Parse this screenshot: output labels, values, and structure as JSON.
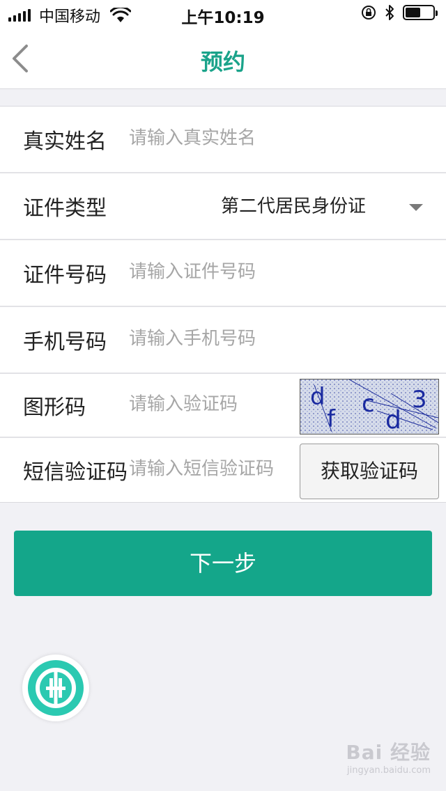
{
  "status_bar": {
    "carrier": "中国移动",
    "time": "上午10:19",
    "battery_level": 0.55
  },
  "nav": {
    "title": "预约"
  },
  "form": {
    "name": {
      "label": "真实姓名",
      "placeholder": "请输入真实姓名"
    },
    "id_type": {
      "label": "证件类型",
      "value": "第二代居民身份证"
    },
    "id_number": {
      "label": "证件号码",
      "placeholder": "请输入证件号码"
    },
    "phone": {
      "label": "手机号码",
      "placeholder": "请输入手机号码"
    },
    "captcha": {
      "label": "图形码",
      "placeholder": "请输入验证码",
      "chars": [
        "d",
        "f",
        "c",
        "d",
        "3"
      ]
    },
    "sms": {
      "label": "短信验证码",
      "placeholder": "请输入短信验证码",
      "button_label": "获取验证码"
    }
  },
  "next_button": {
    "label": "下一步"
  },
  "watermark": {
    "main": "Bai 经验",
    "sub": "jingyan.baidu.com"
  },
  "colors": {
    "accent": "#14a68a",
    "title": "#1aa38a",
    "background": "#f1f1f5"
  }
}
